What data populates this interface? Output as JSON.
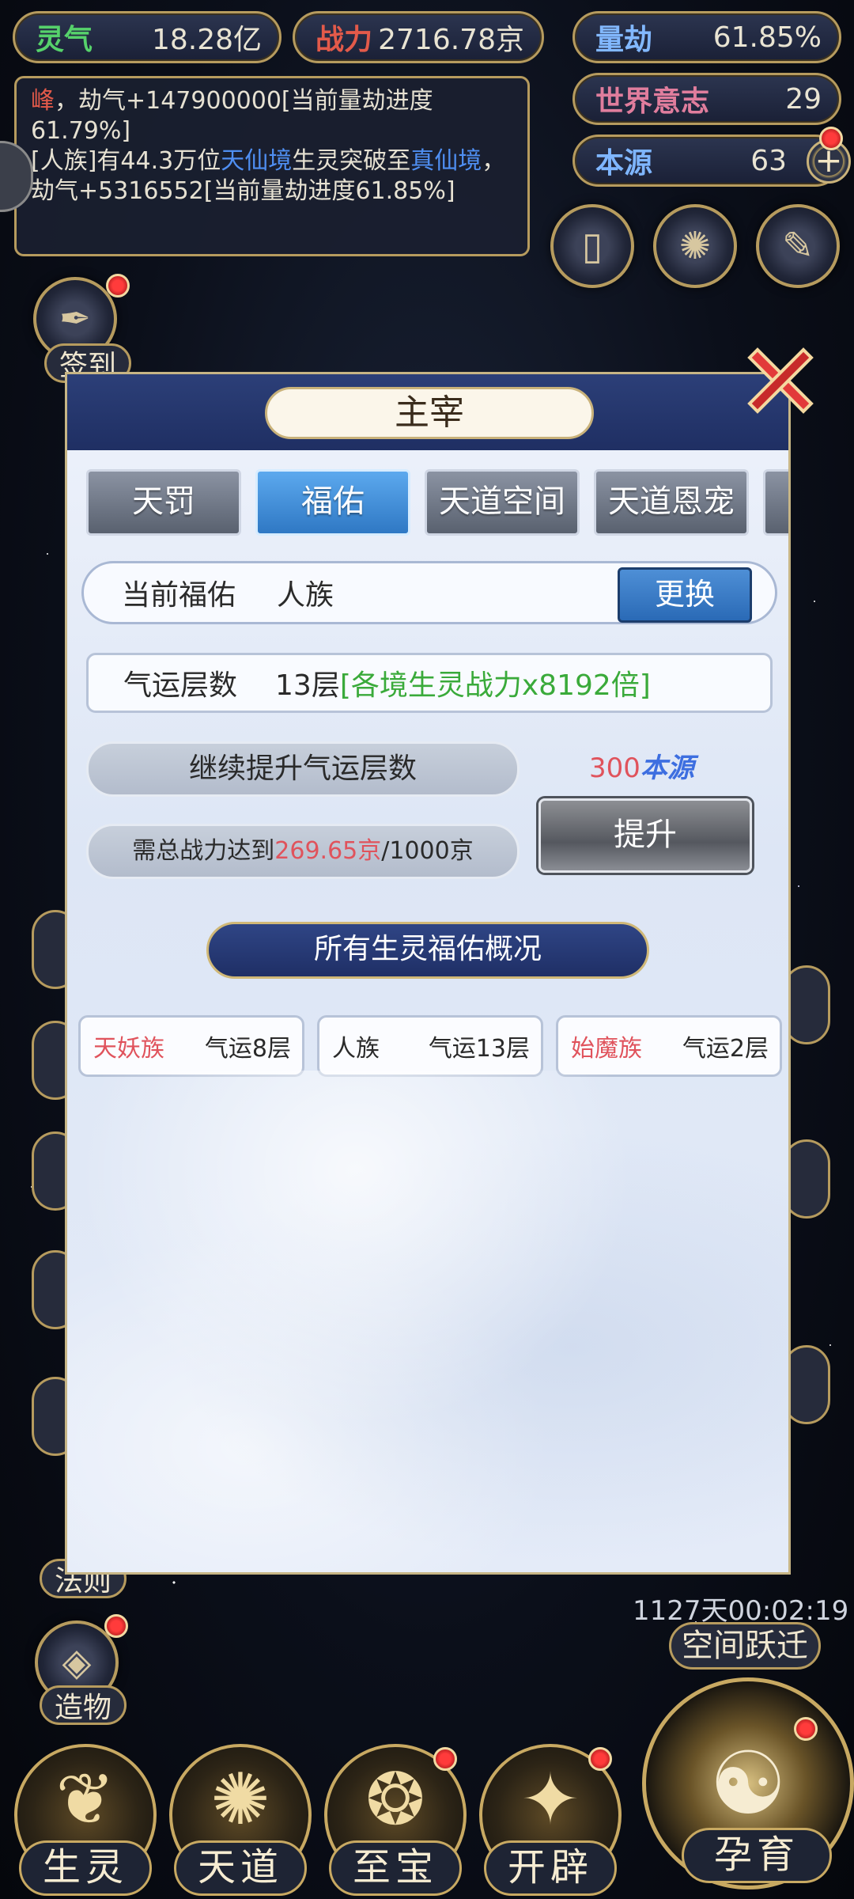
{
  "top_bar": {
    "lingqi": {
      "label": "灵气",
      "value": "18.28亿"
    },
    "zhanli": {
      "label": "战力",
      "value": "2716.78京"
    },
    "liangjie": {
      "label": "量劫",
      "value": "61.85%"
    },
    "shijie_yizhi": {
      "label": "世界意志",
      "value": "29"
    },
    "benyuan": {
      "label": "本源",
      "value": "63"
    }
  },
  "log": {
    "line1_name": "峰",
    "line1_rest": "，劫气+147900000[当前量劫进度61.79%]",
    "line2_a": "[人族]有44.3万位",
    "line2_realm1": "天仙境",
    "line2_b": "生灵突破至",
    "line2_realm2": "真仙境",
    "line2_c": "，劫气+5316552[当前量劫进度61.85%]"
  },
  "side_buttons": {
    "qiandao": "签到",
    "fazhe": "法则",
    "zaowu": "造物"
  },
  "modal": {
    "title": "主宰",
    "tabs": [
      "天罚",
      "福佑",
      "天道空间",
      "天道恩宠"
    ],
    "active_tab": "福佑",
    "current_label": "当前福佑",
    "current_value": "人族",
    "change_button": "更换",
    "qiyun_label": "气运层数",
    "qiyun_value": "13层",
    "qiyun_bonus": "[各境生灵战力x8192倍]",
    "upgrade_label": "继续提升气运层数",
    "cost_number": "300",
    "cost_unit": "本源",
    "need_prefix": "需总战力达到",
    "need_current": "269.65京",
    "need_target": "/1000京",
    "tisheng_button": "提升",
    "overview_title": "所有生灵福佑概况",
    "races": [
      {
        "name": "天妖族",
        "qiyun": "气运8层"
      },
      {
        "name": "人族",
        "qiyun": "气运13层"
      },
      {
        "name": "始魔族",
        "qiyun": "气运2层"
      }
    ]
  },
  "timer": "1127天00:02:19",
  "teleport_button": "空间跃迁",
  "bottom_nav": [
    "生灵",
    "天道",
    "至宝",
    "开辟",
    "孕育"
  ],
  "colors": {
    "accent_gold": "#b69b5e",
    "modal_header": "#1f2f63",
    "tab_active": "#2f78c4",
    "highlight_red": "#e0535c",
    "highlight_green": "#3aaa3a"
  }
}
